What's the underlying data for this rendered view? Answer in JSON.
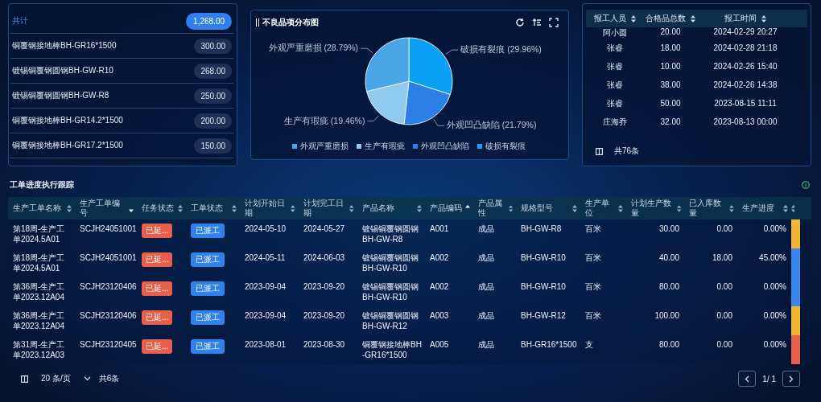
{
  "summary_list": [
    {
      "kind": "total",
      "label": "共计",
      "value": "1,268.00"
    },
    {
      "kind": "item",
      "label": "铜覆钢接地棒BH-GR16*1500",
      "value": "300.00"
    },
    {
      "kind": "item",
      "label": "镀锡铜覆钢圆钢BH-GW-R10",
      "value": "268.00"
    },
    {
      "kind": "item",
      "label": "镀锡铜覆钢圆钢BH-GW-R8",
      "value": "250.00"
    },
    {
      "kind": "item",
      "label": "铜覆钢接地棒BH-GR14.2*1500",
      "value": "200.00"
    },
    {
      "kind": "item",
      "label": "铜覆钢接地棒BH-GR17.2*1500",
      "value": "150.00"
    }
  ],
  "defect_panel": {
    "title": "不良品项分布图",
    "chart_data": {
      "type": "pie",
      "categories": [
        "破损有裂痕",
        "外观凹凸缺陷",
        "生产有瑕疵",
        "外观严重磨损"
      ],
      "series": [
        {
          "values": [
            29.96,
            21.79,
            19.46,
            28.79
          ]
        }
      ],
      "colors": [
        "#0aa0f5",
        "#2b7fe6",
        "#8fcbf0",
        "#4aa5e6"
      ],
      "value_labels": [
        "破损有裂痕 (29.96%)",
        "外观凹凸缺陷 (21.79%)",
        "生产有瑕疵 (19.46%)",
        "外观严重磨损 (28.79%)"
      ]
    }
  },
  "report_table": {
    "columns": [
      "报工人员",
      "合格品总数",
      "报工时间"
    ],
    "rows": [
      [
        "阿小圆",
        "20.00",
        "2024-02-29 20:27"
      ],
      [
        "张睿",
        "18.00",
        "2024-02-28 21:18"
      ],
      [
        "张睿",
        "10.00",
        "2024-02-26 15:40"
      ],
      [
        "张睿",
        "38.00",
        "2024-02-26 14:38"
      ],
      [
        "张睿",
        "50.00",
        "2023-08-15 11:11"
      ],
      [
        "庄海乔",
        "32.00",
        "2023-08-13 00:00"
      ]
    ],
    "total": "共76条"
  },
  "progress_section": {
    "title": "工单进度执行跟踪",
    "columns": [
      {
        "label": "生产工单名称",
        "sorted_ascending": false,
        "sorted_descending": false
      },
      {
        "label": "生产工单编号",
        "sorted_ascending": false,
        "sorted_descending": true
      },
      {
        "label": "任务状态",
        "sorted_ascending": false,
        "sorted_descending": false
      },
      {
        "label": "工单状态",
        "sorted_ascending": false,
        "sorted_descending": false
      },
      {
        "label": "计划开始日期",
        "sorted_ascending": false,
        "sorted_descending": false
      },
      {
        "label": "计划完工日期",
        "sorted_ascending": false,
        "sorted_descending": false
      },
      {
        "label": "产品名称",
        "sorted_ascending": false,
        "sorted_descending": false
      },
      {
        "label": "产品编码",
        "sorted_ascending": true,
        "sorted_descending": false
      },
      {
        "label": "产品属性",
        "sorted_ascending": false,
        "sorted_descending": false
      },
      {
        "label": "规格型号",
        "sorted_ascending": false,
        "sorted_descending": false
      },
      {
        "label": "生产单位",
        "sorted_ascending": false,
        "sorted_descending": false
      },
      {
        "label": "计划生产数量",
        "sorted_ascending": false,
        "sorted_descending": false
      },
      {
        "label": "已入库数量",
        "sorted_ascending": false,
        "sorted_descending": false
      },
      {
        "label": "生产进度",
        "sorted_ascending": false,
        "sorted_descending": false
      }
    ],
    "rows": [
      {
        "name": "第18周-生产工单2024.5A01",
        "code": "SCJH24051001",
        "task_status": "已延...",
        "order_status": "已派工",
        "start": "2024-05-10",
        "end": "2024-05-27",
        "product": "镀锡铜覆钢圆钢BH-GW-R8",
        "product_code": "A001",
        "attribute": "成品",
        "spec": "BH-GW-R8",
        "unit": "百米",
        "planned": "30.00",
        "stocked": "0.00",
        "progress": "0.00%",
        "color": "#f2b632"
      },
      {
        "name": "第18周-生产工单2024.5A01",
        "code": "SCJH24051001",
        "task_status": "已延...",
        "order_status": "已派工",
        "start": "2024-05-11",
        "end": "2024-06-03",
        "product": "镀锡铜覆钢圆钢BH-GW-R10",
        "product_code": "A002",
        "attribute": "成品",
        "spec": "BH-GW-R10",
        "unit": "百米",
        "planned": "40.00",
        "stocked": "18.00",
        "progress": "45.00%",
        "color": "#3a86ef"
      },
      {
        "name": "第36周-生产工单2023.12A04",
        "code": "SCJH23120406",
        "task_status": "已延...",
        "order_status": "已派工",
        "start": "2023-09-04",
        "end": "2023-09-20",
        "product": "镀锡铜覆钢圆钢BH-GW-R10",
        "product_code": "A002",
        "attribute": "成品",
        "spec": "BH-GW-R10",
        "unit": "百米",
        "planned": "80.00",
        "stocked": "0.00",
        "progress": "0.00%",
        "color": "#3a86ef"
      },
      {
        "name": "第36周-生产工单2023.12A04",
        "code": "SCJH23120406",
        "task_status": "已延...",
        "order_status": "已派工",
        "start": "2023-09-04",
        "end": "2023-09-20",
        "product": "镀锡铜覆钢圆钢BH-GW-R12",
        "product_code": "A003",
        "attribute": "成品",
        "spec": "BH-GW-R12",
        "unit": "百米",
        "planned": "100.00",
        "stocked": "0.00",
        "progress": "0.00%",
        "color": "#f2b632"
      },
      {
        "name": "第31周-生产工单2023.12A03",
        "code": "SCJH23120405",
        "task_status": "已延...",
        "order_status": "已派工",
        "start": "2023-08-01",
        "end": "2023-08-30",
        "product": "铜覆钢接地棒BH-GR16*1500",
        "product_code": "A005",
        "attribute": "成品",
        "spec": "BH-GR16*1500",
        "unit": "支",
        "planned": "80.00",
        "stocked": "0.00",
        "progress": "0.00%",
        "color": "#e8604c"
      }
    ],
    "pagination": {
      "page_size": "20 条/页",
      "total": "共6条",
      "page": "1",
      "pages": "/ 1"
    }
  }
}
